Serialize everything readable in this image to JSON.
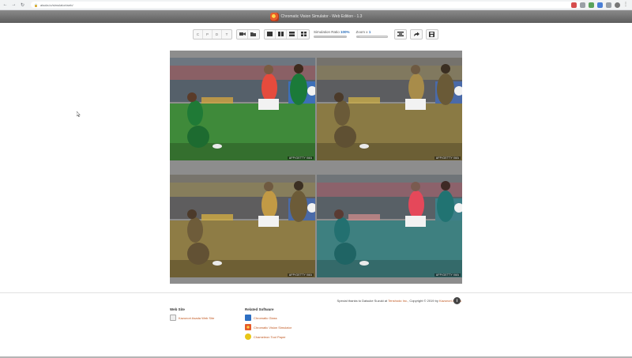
{
  "browser": {
    "url": "aisola.io/simulator/web/",
    "back_icon": "arrow-left-icon",
    "forward_icon": "arrow-right-icon",
    "reload_icon": "reload-icon"
  },
  "app": {
    "title": "Chromatic Vision Simulator - Web Edition - 1.3"
  },
  "toolbar": {
    "mode_buttons": [
      "C",
      "P",
      "D",
      "T"
    ],
    "simulation_ratio_label": "Simulation Ratio",
    "simulation_ratio_value": "100%",
    "simulation_ratio_level": 1.0,
    "zoom_label": "Zoom x",
    "zoom_value": "1",
    "zoom_level": 0.1
  },
  "panels": [
    {
      "watermark": "AFP/GETTY IMA"
    },
    {
      "watermark": "AFP/GETTY IMA"
    },
    {
      "watermark": "AFP/GETTY IMA"
    },
    {
      "watermark": "AFP/GETTY IMA"
    }
  ],
  "footer": {
    "credits_prefix": "Special thanks to Daisuke Suzuki at",
    "credits_link": "Tenshodo Inc.",
    "credits_mid": ", Copyright © 2019 by",
    "credits_author": "Kazunori Asada",
    "web_site_heading": "Web Site",
    "web_site_links": [
      "Kazunori Asada Web Site"
    ],
    "related_heading": "Related Software",
    "related_links": [
      "Chromatic Glass",
      "Chromatic Vision Simulator",
      "Chameleon Tool Paper"
    ]
  },
  "colors": {
    "link": "#c0571f",
    "accent": "#2a6ebb",
    "title_bar": "#6d6d6d"
  }
}
